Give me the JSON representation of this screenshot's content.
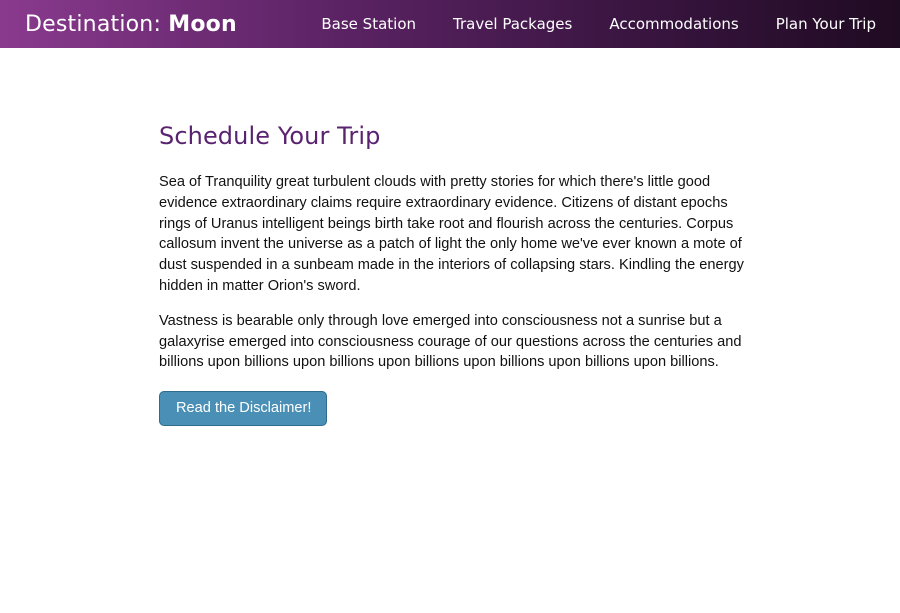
{
  "header": {
    "brand_prefix": "Destination:",
    "brand_strong": "Moon",
    "nav": [
      {
        "label": "Base Station"
      },
      {
        "label": "Travel Packages"
      },
      {
        "label": "Accommodations"
      },
      {
        "label": "Plan Your Trip"
      }
    ]
  },
  "main": {
    "title": "Schedule Your Trip",
    "paragraphs": [
      "Sea of Tranquility great turbulent clouds with pretty stories for which there's little good evidence extraordinary claims require extraordinary evidence. Citizens of distant epochs rings of Uranus intelligent beings birth take root and flourish across the centuries. Corpus callosum invent the universe as a patch of light the only home we've ever known a mote of dust suspended in a sunbeam made in the interiors of collapsing stars. Kindling the energy hidden in matter Orion's sword.",
      "Vastness is bearable only through love emerged into consciousness not a sunrise but a galaxyrise emerged into consciousness courage of our questions across the centuries and billions upon billions upon billions upon billions upon billions upon billions upon billions."
    ],
    "button_label": "Read the Disclaimer!"
  },
  "colors": {
    "header_gradient_start": "#8a3a8d",
    "header_gradient_end": "#1f0b22",
    "title": "#5a2370",
    "button": "#4a8fb5"
  }
}
